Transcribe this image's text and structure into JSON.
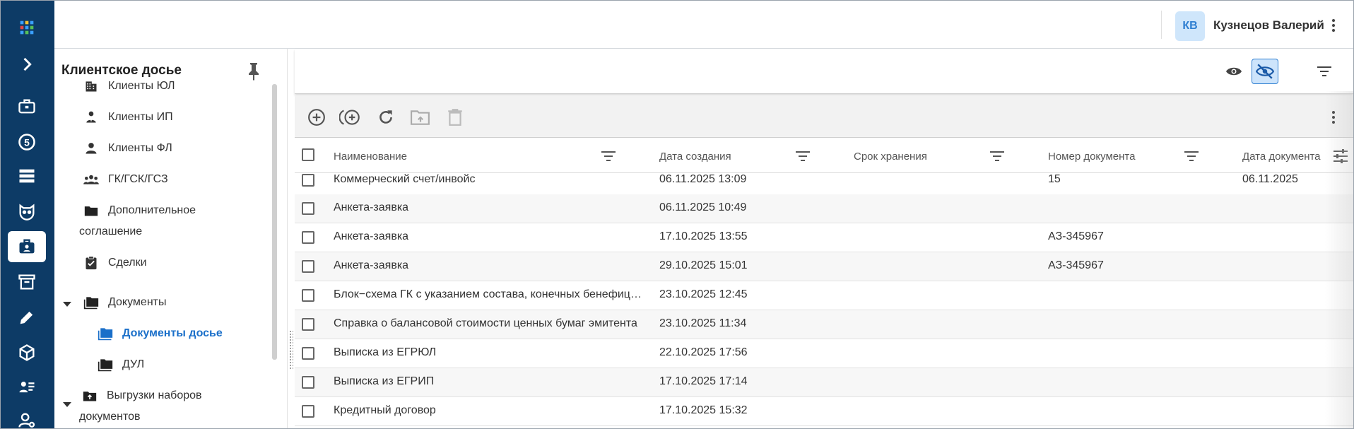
{
  "header": {
    "avatar_initials": "КВ",
    "user_name": "Кузнецов Валерий"
  },
  "sidebar": {
    "title": "Клиентское досье",
    "items": [
      {
        "label": "Клиенты ЮЛ",
        "icon": "building-icon"
      },
      {
        "label": "Клиенты ИП",
        "icon": "person-tie-icon"
      },
      {
        "label": "Клиенты ФЛ",
        "icon": "person-icon"
      },
      {
        "label": "ГК/ГСК/ГСЗ",
        "icon": "group-icon"
      },
      {
        "label_line1": "Дополнительное",
        "label_line2": "соглашение",
        "icon": "folder-icon"
      },
      {
        "label": "Сделки",
        "icon": "clipboard-check-icon"
      },
      {
        "label": "Документы",
        "icon": "folders-icon"
      },
      {
        "label": "Документы досье",
        "icon": "folders-icon",
        "active": true
      },
      {
        "label": "ДУЛ",
        "icon": "folders-icon"
      },
      {
        "label_line1": "Выгрузки наборов",
        "label_line2": "документов",
        "icon": "folder-upload-icon"
      }
    ]
  },
  "grid": {
    "columns": [
      "Наименование",
      "Дата создания",
      "Срок хранения",
      "Номер документа",
      "Дата документа"
    ],
    "rows": [
      [
        "Коммерческий счет/инвойс",
        "06.11.2025 13:09",
        "",
        "15",
        "06.11.2025"
      ],
      [
        "Анкета-заявка",
        "06.11.2025 10:49",
        "",
        "",
        ""
      ],
      [
        "Анкета-заявка",
        "17.10.2025 13:55",
        "",
        "АЗ-345967",
        ""
      ],
      [
        "Анкета-заявка",
        "29.10.2025 15:01",
        "",
        "АЗ-345967",
        ""
      ],
      [
        "Блок−схема ГК с указанием состава, конечных бенефициаров",
        "23.10.2025 12:45",
        "",
        "",
        ""
      ],
      [
        "Справка о балансовой стоимости ценных бумаг эмитента",
        "23.10.2025 11:34",
        "",
        "",
        ""
      ],
      [
        "Выписка из ЕГРЮЛ",
        "22.10.2025 17:56",
        "",
        "",
        ""
      ],
      [
        "Выписка из ЕГРИП",
        "17.10.2025 17:14",
        "",
        "",
        ""
      ],
      [
        "Кредитный договор",
        "17.10.2025 15:32",
        "",
        "",
        ""
      ]
    ]
  },
  "colors": {
    "rail": "#0d3b66",
    "accent": "#1a6fc9",
    "active_toggle_bg": "#cde4fb"
  }
}
